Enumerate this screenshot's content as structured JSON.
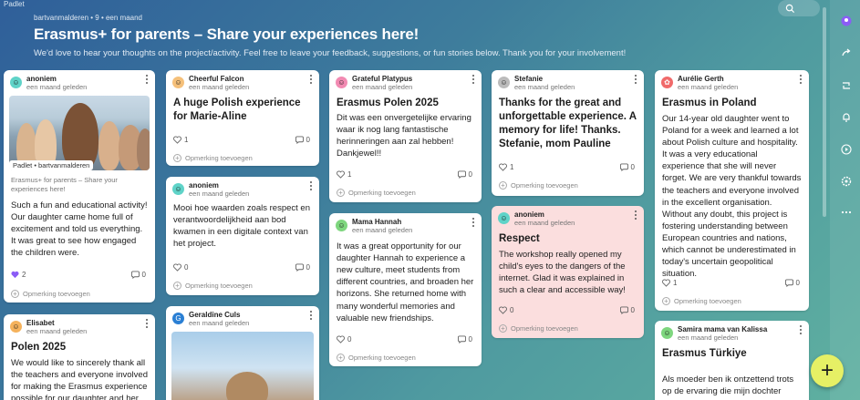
{
  "app": {
    "label": "Padlet"
  },
  "header": {
    "meta": "bartvanmalderen • 9 • een maand",
    "title": "Erasmus+ for parents – Share your experiences here!",
    "subtitle": "We'd love to hear your thoughts on the project/activity. Feel free to leave your feedback, suggestions, or fun stories below. Thank you for your involvement!"
  },
  "colors": {
    "fab": "#e6f065",
    "pink_card": "#fbdede"
  },
  "add_comment": "Opmerking toevoegen",
  "cards": {
    "c1": {
      "author": "anoniem",
      "time": "een maand geleden",
      "caption": "Padlet • bartvanmalderen",
      "photo_sub": "Erasmus+ for parents – Share your experiences here!",
      "body": "Such a fun and educational activity! Our daughter came home full of excitement and told us everything. It was great to see how engaged the children were.",
      "likes": "2",
      "comments": "0"
    },
    "c2": {
      "author": "Elisabet",
      "time": "een maand geleden",
      "title": "Polen 2025",
      "body": "We would like to sincerely thank all the teachers and everyone involved for making the Erasmus experience possible for our daughter and her"
    },
    "c3": {
      "author": "Cheerful Falcon",
      "time": "een maand geleden",
      "title": "A huge Polish experience for Marie-Aline",
      "likes": "1",
      "comments": "0"
    },
    "c4": {
      "author": "anoniem",
      "time": "een maand geleden",
      "body": "Mooi hoe waarden zoals respect en verantwoordelijkheid aan bod kwamen in een digitale context van het project.",
      "likes": "0",
      "comments": "0"
    },
    "c5": {
      "author": "Geraldine Culs",
      "time": "een maand geleden"
    },
    "c6": {
      "author": "Grateful Platypus",
      "time": "een maand geleden",
      "title": "Erasmus Polen 2025",
      "body": "Dit was een onvergetelijke ervaring waar ik nog lang fantastische herinneringen aan zal hebben! Dankjewel!!",
      "likes": "1",
      "comments": "0"
    },
    "c7": {
      "author": "Mama Hannah",
      "time": "een maand geleden",
      "body": "It was a great opportunity for our daughter Hannah to experience a new culture, meet students from different countries, and broaden her horizons. She returned home with many wonderful memories and valuable new friendships.",
      "likes": "0",
      "comments": "0"
    },
    "c8": {
      "author": "Stefanie",
      "time": "een maand geleden",
      "title": "Thanks for the great and unforgettable experience. A memory for life! Thanks. Stefanie, mom Pauline",
      "likes": "1",
      "comments": "0"
    },
    "c9": {
      "author": "anoniem",
      "time": "een maand geleden",
      "title": "Respect",
      "body": "The workshop really opened my child's eyes to the dangers of the internet. Glad it was explained in such a clear and accessible way!",
      "likes": "0",
      "comments": "0"
    },
    "c10": {
      "author": "Aurélie Gerth",
      "time": "een maand geleden",
      "title": "Erasmus in Poland",
      "body": "Our 14-year old daughter went to Poland for a week and learned a lot about Polish culture and hospitality. It was a very educational experience that she will never forget. We are very thankful towards the teachers and everyone involved in the excellent  organisation. Without any doubt, this project is fostering understanding between European countries and nations, which cannot be underestimated in today's uncertain geopolitical situation.",
      "likes": "1",
      "comments": "0"
    },
    "c11": {
      "author": "Samira mama van Kalissa",
      "time": "een maand geleden",
      "title": "Erasmus Türkiye",
      "body": "Als moeder ben ik ontzettend trots op de ervaring die mijn dochter"
    }
  }
}
